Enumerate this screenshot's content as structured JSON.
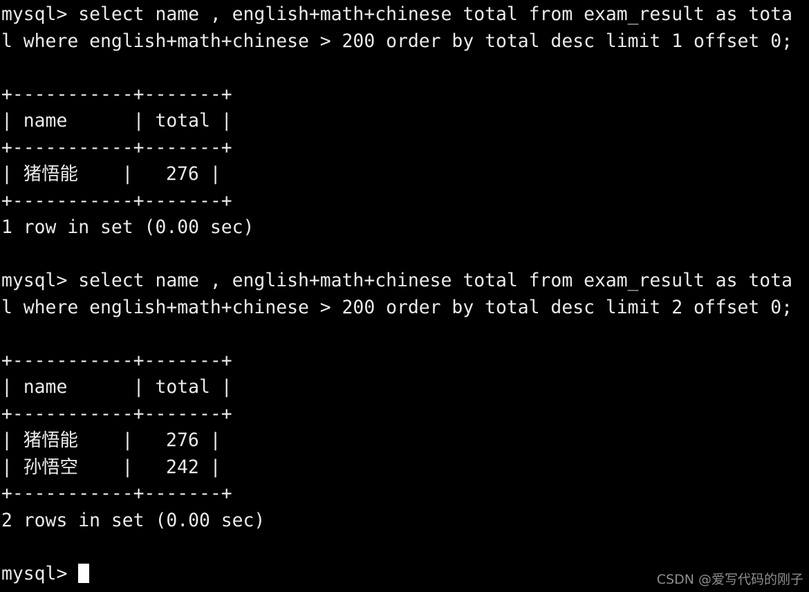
{
  "terminal": {
    "background_color": "#000000",
    "foreground_color": "#eaeaea",
    "columns": 72,
    "lines": [
      "mysql> select name , english+math+chinese total from exam_result as tota",
      "l where english+math+chinese > 200 order by total desc limit 1 offset 0;",
      "",
      "+-----------+-------+",
      "| name      | total |",
      "+-----------+-------+",
      "| 猪悟能    |   276 |",
      "+-----------+-------+",
      "1 row in set (0.00 sec)",
      "",
      "mysql> select name , english+math+chinese total from exam_result as tota",
      "l where english+math+chinese > 200 order by total desc limit 2 offset 0;",
      "",
      "+-----------+-------+",
      "| name      | total |",
      "+-----------+-------+",
      "| 猪悟能    |   276 |",
      "| 孙悟空    |   242 |",
      "+-----------+-------+",
      "2 rows in set (0.00 sec)",
      "",
      ""
    ],
    "prompt": {
      "text": "mysql> ",
      "cursor": "block"
    }
  },
  "queries": [
    {
      "prompt": "mysql>",
      "sql": "select name , english+math+chinese total from exam_result as total where english+math+chinese > 200 order by total desc limit 1 offset 0;",
      "result": {
        "columns": [
          "name",
          "total"
        ],
        "rows": [
          [
            "猪悟能",
            "276"
          ]
        ],
        "status": "1 row in set (0.00 sec)"
      }
    },
    {
      "prompt": "mysql>",
      "sql": "select name , english+math+chinese total from exam_result as total where english+math+chinese > 200 order by total desc limit 2 offset 0;",
      "result": {
        "columns": [
          "name",
          "total"
        ],
        "rows": [
          [
            "猪悟能",
            "276"
          ],
          [
            "孙悟空",
            "242"
          ]
        ],
        "status": "2 rows in set (0.00 sec)"
      }
    }
  ],
  "watermark": {
    "text": "CSDN @爱写代码的刚子",
    "color": "#8e8e8e"
  }
}
